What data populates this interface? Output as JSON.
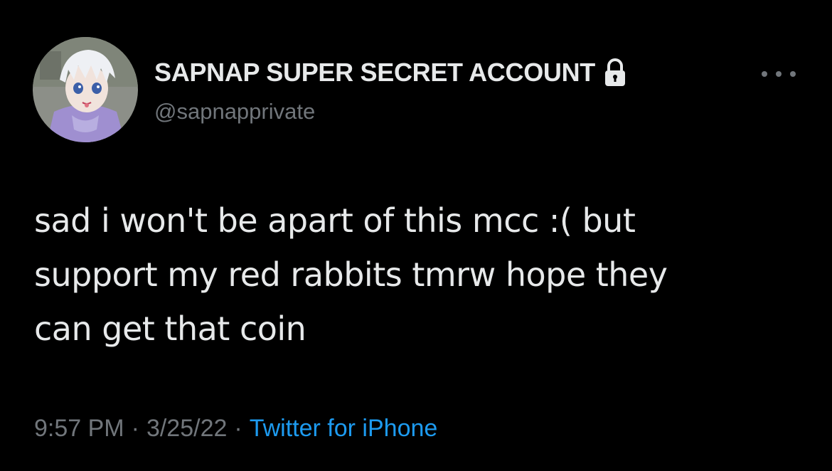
{
  "user": {
    "display_name": "SAPNAP SUPER SECRET ACCOUNT",
    "handle": "@sapnapprivate",
    "avatar_icon": "anime-character-avatar",
    "lock_icon": "lock-icon"
  },
  "tweet": {
    "lines": [
      "sad i won't be apart of this mcc :( but",
      "support my red rabbits tmrw hope they",
      "can get that coin"
    ],
    "time": "9:57 PM",
    "separator": "·",
    "date": "3/25/22",
    "source": "Twitter for iPhone"
  },
  "colors": {
    "background": "#000000",
    "text": "#e7e9ea",
    "muted": "#71767b",
    "link": "#1d9bf0"
  }
}
